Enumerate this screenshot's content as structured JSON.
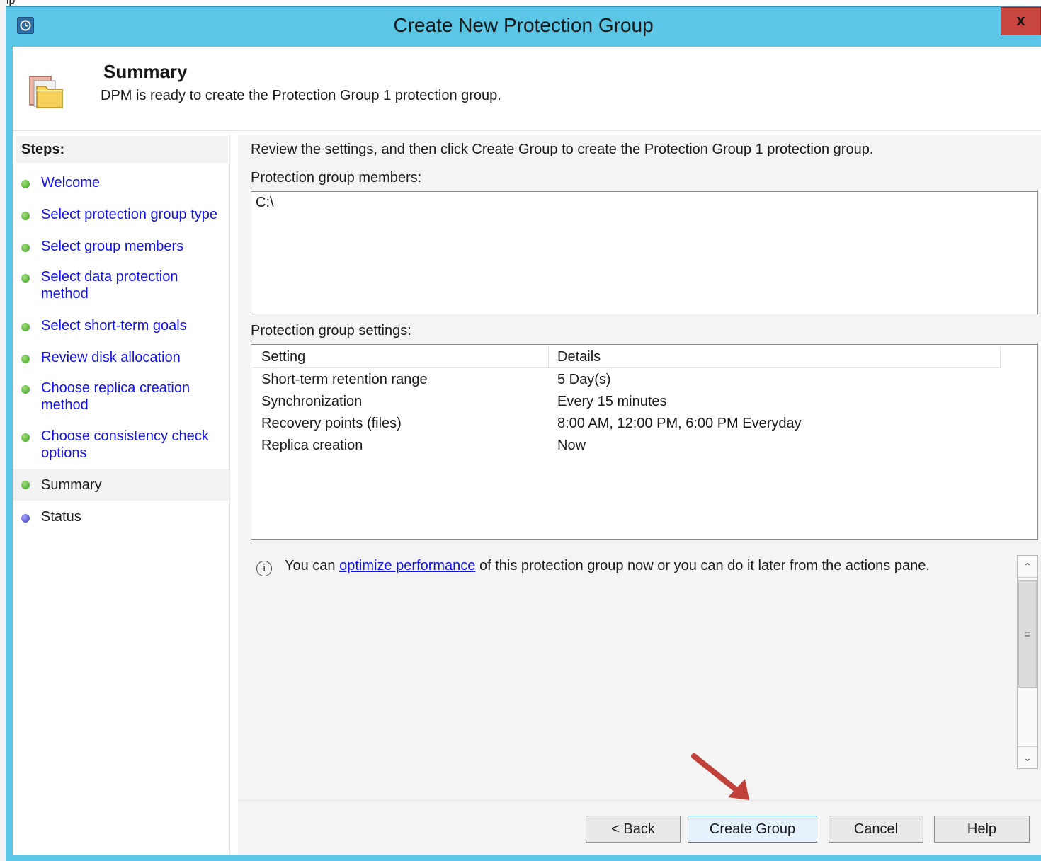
{
  "background": {
    "text": "elp"
  },
  "window": {
    "title": "Create New Protection Group",
    "close_label": "x",
    "titlebar_color": "#5bc6e6",
    "close_color": "#c8463f"
  },
  "header": {
    "title": "Summary",
    "subtitle": "DPM is ready to create the Protection Group 1 protection group."
  },
  "steps": {
    "title": "Steps:",
    "items": [
      {
        "label": "Welcome",
        "status": "complete"
      },
      {
        "label": "Select protection group type",
        "status": "complete"
      },
      {
        "label": "Select group members",
        "status": "complete"
      },
      {
        "label": "Select data protection method",
        "status": "complete"
      },
      {
        "label": "Select short-term goals",
        "status": "complete"
      },
      {
        "label": "Review disk allocation",
        "status": "complete"
      },
      {
        "label": "Choose replica creation method",
        "status": "complete"
      },
      {
        "label": "Choose consistency check options",
        "status": "complete"
      },
      {
        "label": "Summary",
        "status": "current"
      },
      {
        "label": "Status",
        "status": "pending"
      }
    ]
  },
  "main": {
    "instruction": "Review the settings, and then click Create Group to create the Protection Group 1 protection group.",
    "members_label": "Protection group members:",
    "members": [
      "C:\\"
    ],
    "settings_label": "Protection group settings:",
    "settings_columns": [
      "Setting",
      "Details"
    ],
    "settings_rows": [
      [
        "Short-term retention range",
        "5 Day(s)"
      ],
      [
        "Synchronization",
        "Every 15 minutes"
      ],
      [
        "Recovery points (files)",
        "8:00 AM, 12:00 PM, 6:00 PM Everyday"
      ],
      [
        "Replica creation",
        "Now"
      ]
    ],
    "info": {
      "prefix": "You can ",
      "link": "optimize performance",
      "suffix": " of this protection group now or you can do it later from the actions pane."
    }
  },
  "buttons": {
    "back": "< Back",
    "create": "Create Group",
    "cancel": "Cancel",
    "help": "Help"
  },
  "icons": {
    "app": "dpm-clock-icon",
    "header": "folder-icon",
    "info": "info-icon",
    "annotation": "red-arrow-icon",
    "annotation_color": "#c0413a"
  }
}
